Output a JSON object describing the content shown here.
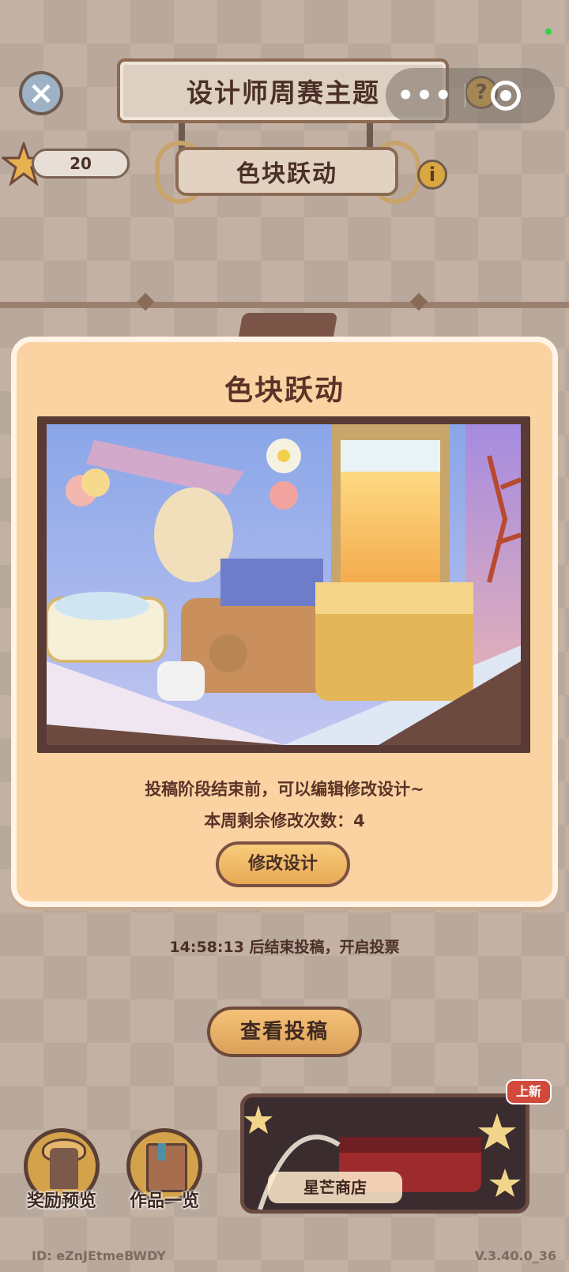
{
  "header": {
    "title": "设计师周赛主题",
    "theme": "色块跃动",
    "star_count": "20",
    "help_glyph": "?",
    "info_glyph": "i",
    "close_glyph": "×",
    "more_glyph": "•••"
  },
  "modal": {
    "title": "色块跃动",
    "line1": "投稿阶段结束前，可以编辑修改设计~",
    "line2": "本周剩余修改次数：4",
    "edit_button": "修改设计"
  },
  "status": {
    "timer_text": "14:58:13  后结束投稿，开启投票"
  },
  "actions": {
    "view_submissions": "查看投稿"
  },
  "bottom_nav": {
    "rewards_label": "奖励预览",
    "works_label": "作品一览",
    "shop_label": "星芒商店",
    "shop_badge": "上新"
  },
  "footer": {
    "id_text": "ID:  eZnJEtmeBWDY",
    "version": "V.3.40.0_36"
  },
  "colors": {
    "modal_bg": "#fbd3a2",
    "title_text": "#5a3328",
    "button_fill": "#e8a955",
    "badge_red": "#d0493a"
  }
}
